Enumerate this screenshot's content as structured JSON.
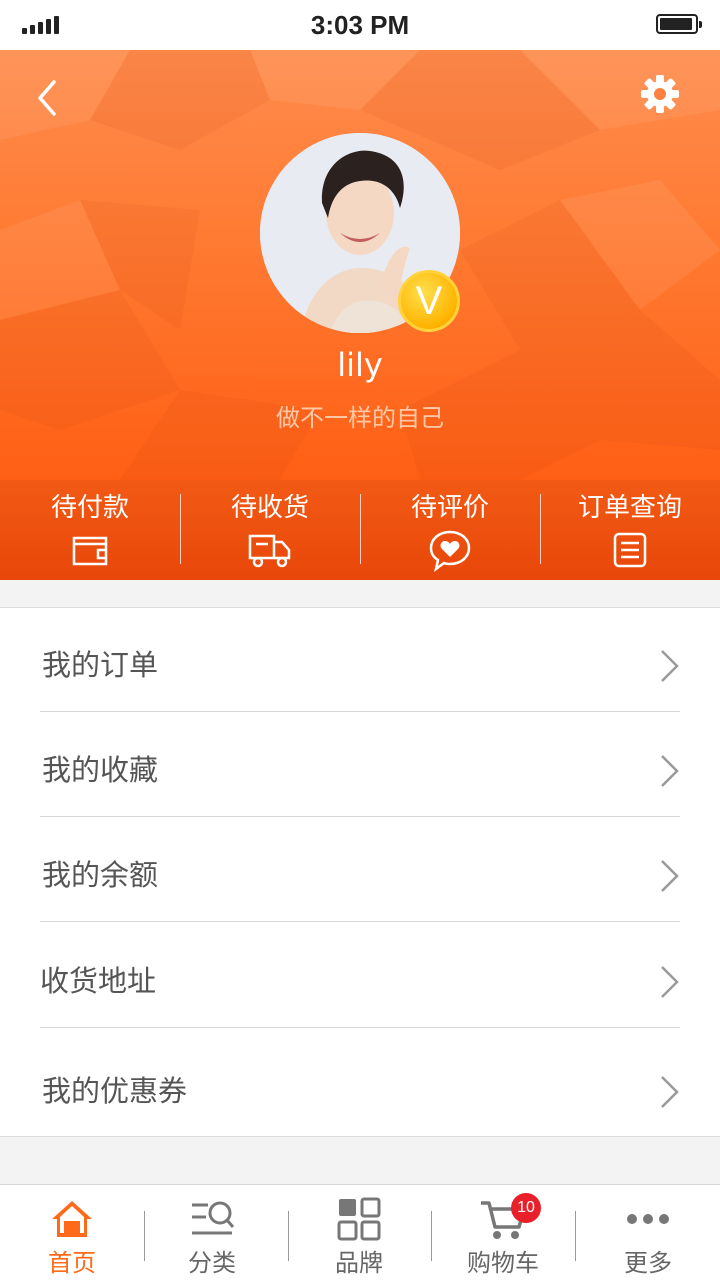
{
  "status_bar": {
    "time": "3:03 PM",
    "signal_icon": "signal-bars-icon",
    "battery_icon": "battery-full-icon"
  },
  "header": {
    "back_icon": "chevron-left-icon",
    "settings_icon": "gear-icon",
    "username": "lily",
    "motto": "做不一样的自己",
    "vip_badge": "V",
    "colors": {
      "top": "#ff8c4d",
      "bottom": "#ff5f14",
      "bar": "#e8470a"
    }
  },
  "order_status": [
    {
      "label": "待付款",
      "icon": "wallet-icon"
    },
    {
      "label": "待收货",
      "icon": "delivery-truck-icon"
    },
    {
      "label": "待评价",
      "icon": "heart-chat-icon"
    },
    {
      "label": "订单查询",
      "icon": "document-list-icon"
    }
  ],
  "menu": [
    {
      "label": "我的订单"
    },
    {
      "label": "我的收藏"
    },
    {
      "label": "我的余额"
    },
    {
      "label": "收货地址"
    },
    {
      "label": "我的优惠券"
    }
  ],
  "tabbar": {
    "accent_color": "#ff6a1a",
    "items": [
      {
        "label": "首页",
        "icon": "home-icon",
        "active": true
      },
      {
        "label": "分类",
        "icon": "category-search-icon",
        "active": false
      },
      {
        "label": "品牌",
        "icon": "grid-icon",
        "active": false
      },
      {
        "label": "购物车",
        "icon": "cart-icon",
        "active": false,
        "badge": "10"
      },
      {
        "label": "更多",
        "icon": "more-dots-icon",
        "active": false
      }
    ]
  }
}
